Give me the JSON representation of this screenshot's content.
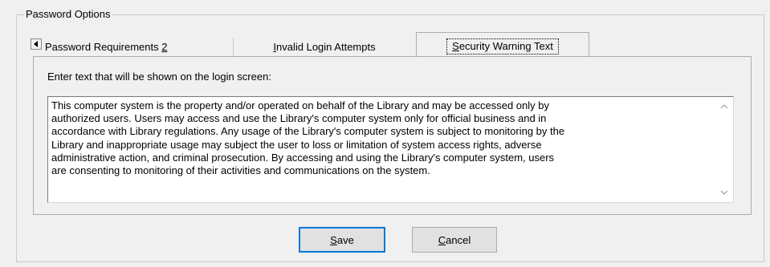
{
  "group": {
    "title": "Password Options"
  },
  "tabs": [
    {
      "label_pre": "Password Requirements ",
      "label_accel": "2",
      "label_post": ""
    },
    {
      "label_pre": "",
      "label_accel": "I",
      "label_post": "nvalid Login Attempts"
    },
    {
      "label_pre": "",
      "label_accel": "S",
      "label_post": "ecurity Warning Text",
      "selected": true
    }
  ],
  "panel": {
    "prompt": "Enter text that will be shown on the login screen:",
    "warning_text": "This computer system is the property and/or operated on behalf of the Library and may be accessed only by\nauthorized users. Users may access and use the Library's computer system only for official business and in\naccordance with Library regulations. Any usage of the Library's computer system is subject to monitoring by the\nLibrary and inappropriate usage may subject the user to loss or limitation of system access rights, adverse\nadministrative action, and criminal prosecution. By accessing and using the Library's computer system, users\nare consenting to monitoring of their activities and communications on the system."
  },
  "buttons": {
    "save": {
      "accel": "S",
      "rest": "ave"
    },
    "cancel": {
      "accel": "C",
      "rest": "ancel"
    }
  },
  "icons": {
    "tab_scroll": "triangle-left-icon",
    "scroll_up": "chevron-up-icon",
    "scroll_down": "chevron-down-icon"
  }
}
